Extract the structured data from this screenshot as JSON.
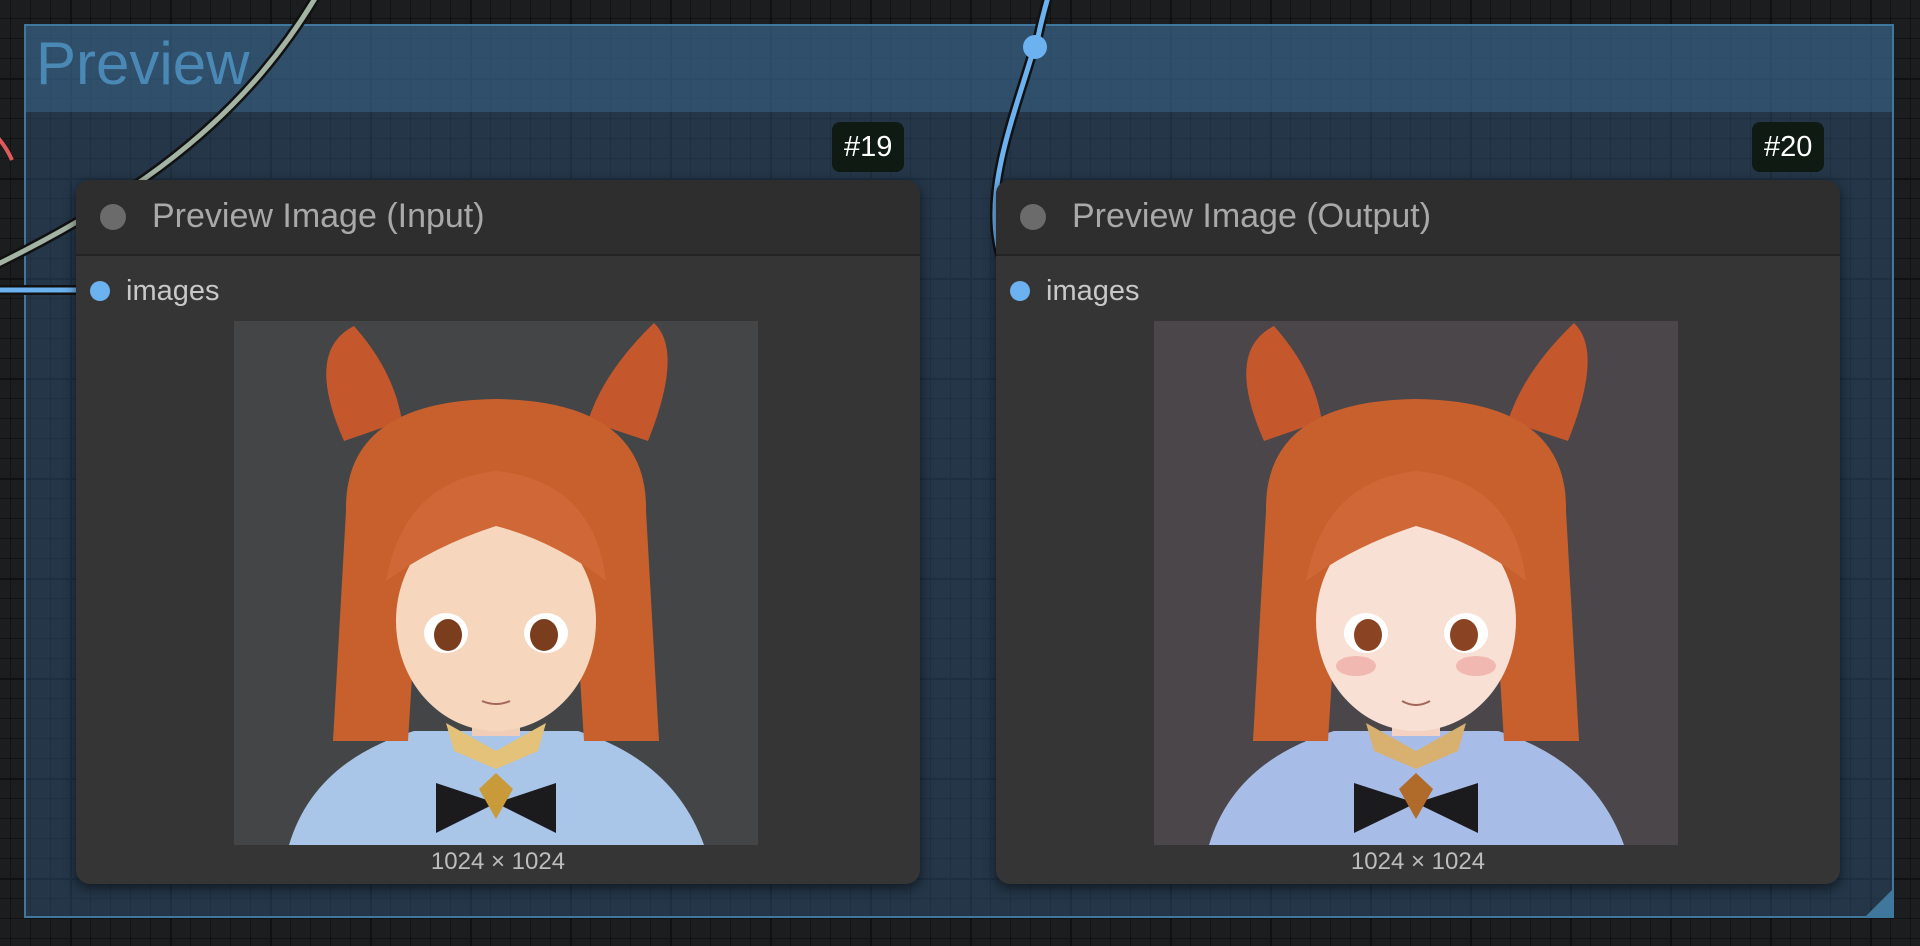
{
  "group": {
    "title": "Preview"
  },
  "nodes": [
    {
      "id_badge": "#19",
      "title": "Preview Image (Input)",
      "input_slot": "images",
      "image_dimensions": "1024 × 1024"
    },
    {
      "id_badge": "#20",
      "title": "Preview Image (Output)",
      "input_slot": "images",
      "image_dimensions": "1024 × 1024"
    }
  ],
  "colors": {
    "group_border": "#3f789c",
    "group_title": "#4a88b6",
    "image_wire": "#6cb1f0",
    "other_wire": "#a4b4a4",
    "red_wire": "#e05a5a",
    "hair": "#c8602e",
    "outfit": "#a9c6e8"
  }
}
